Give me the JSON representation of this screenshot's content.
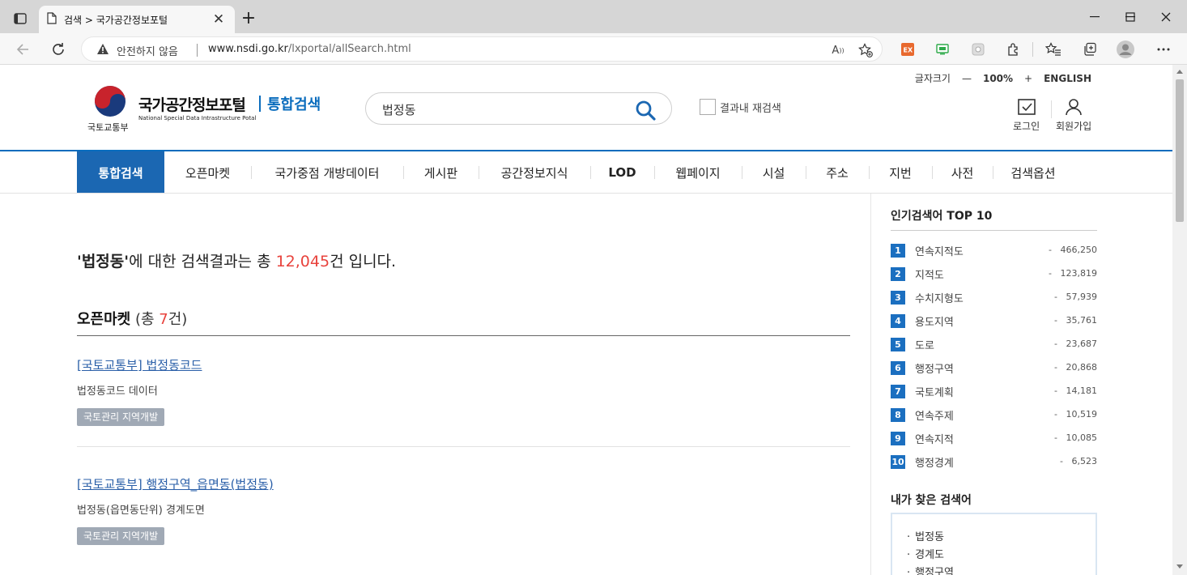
{
  "browser": {
    "tab_title": "검색 > 국가공간정보포털",
    "insecure_label": "안전하지 않음",
    "url_host": "www.nsdi.go.kr",
    "url_path": "/lxportal/allSearch.html"
  },
  "utility": {
    "font_size_label": "글자크기",
    "minus": "—",
    "zoom": "100%",
    "plus": "+",
    "language": "ENGLISH"
  },
  "header": {
    "ministry": "국토교통부",
    "portal_name": "국가공간정보포털",
    "portal_name_en": "National Special Data Intrastructure Potal",
    "integrated_search": "통합검색",
    "search_value": "법정동",
    "re_search_label": "결과내 재검색",
    "login_label": "로그인",
    "signup_label": "회원가입"
  },
  "nav": {
    "items": [
      "통합검색",
      "오픈마켓",
      "국가중점 개방데이터",
      "게시판",
      "공간정보지식",
      "LOD",
      "웹페이지",
      "시설",
      "주소",
      "지번",
      "사전",
      "검색옵션"
    ]
  },
  "results": {
    "summary_quote_open": "'",
    "summary_keyword": "법정동",
    "summary_quote_close": "'",
    "summary_mid": "에 대한 검색결과는 총 ",
    "summary_count": "12,045",
    "summary_end": "건 입니다.",
    "section_title": "오픈마켓",
    "section_paren_open": " (총 ",
    "section_count": "7",
    "section_paren_close": "건)",
    "items": [
      {
        "title": "[국토교통부] 법정동코드",
        "desc": "법정동코드 데이터",
        "tag": "국토관리 지역개발"
      },
      {
        "title": "[국토교통부] 행정구역_읍면동(법정동)",
        "desc": "법정동(읍면동단위) 경계도면",
        "tag": "국토관리 지역개발"
      }
    ]
  },
  "popular": {
    "title": "인기검색어 TOP 10",
    "items": [
      {
        "rank": "1",
        "term": "연속지적도",
        "dash": "-",
        "count": "466,250"
      },
      {
        "rank": "2",
        "term": "지적도",
        "dash": "-",
        "count": "123,819"
      },
      {
        "rank": "3",
        "term": "수치지형도",
        "dash": "-",
        "count": "57,939"
      },
      {
        "rank": "4",
        "term": "용도지역",
        "dash": "-",
        "count": "35,761"
      },
      {
        "rank": "5",
        "term": "도로",
        "dash": "-",
        "count": "23,687"
      },
      {
        "rank": "6",
        "term": "행정구역",
        "dash": "-",
        "count": "20,868"
      },
      {
        "rank": "7",
        "term": "국토계획",
        "dash": "-",
        "count": "14,181"
      },
      {
        "rank": "8",
        "term": "연속주제",
        "dash": "-",
        "count": "10,519"
      },
      {
        "rank": "9",
        "term": "연속지적",
        "dash": "-",
        "count": "10,085"
      },
      {
        "rank": "10",
        "term": "행정경계",
        "dash": "-",
        "count": "6,523"
      }
    ]
  },
  "my_searches": {
    "title": "내가 찾은 검색어",
    "items": [
      "법정동",
      "경계도",
      "행정구역"
    ]
  },
  "colors": {
    "accent": "#1b67b2",
    "count_red": "#e8433d",
    "tag_gray": "#a0a9b5"
  }
}
